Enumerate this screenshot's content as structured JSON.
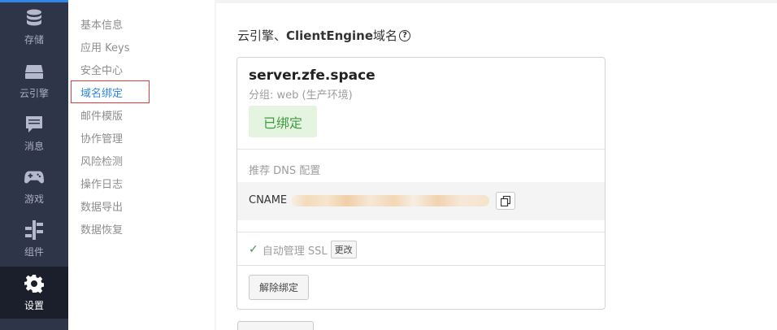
{
  "nav": {
    "items": [
      {
        "label": "存储",
        "icon": "database-icon"
      },
      {
        "label": "云引擎",
        "icon": "server-icon"
      },
      {
        "label": "消息",
        "icon": "message-icon"
      },
      {
        "label": "游戏",
        "icon": "gamepad-icon"
      },
      {
        "label": "组件",
        "icon": "components-icon"
      },
      {
        "label": "设置",
        "icon": "gear-icon",
        "active": true
      }
    ]
  },
  "submenu": {
    "items": [
      {
        "label": "基本信息"
      },
      {
        "label": "应用 Keys"
      },
      {
        "label": "安全中心"
      },
      {
        "label": "域名绑定",
        "active": true
      },
      {
        "label": "邮件模版"
      },
      {
        "label": "协作管理"
      },
      {
        "label": "风险检测"
      },
      {
        "label": "操作日志"
      },
      {
        "label": "数据导出"
      },
      {
        "label": "数据恢复"
      }
    ]
  },
  "main": {
    "title_prefix": "云引擎、",
    "title_bold": "ClientEngine",
    "title_suffix": " 域名",
    "card": {
      "domain": "server.zfe.space",
      "group": "分组: web (生产环境)",
      "status_badge": "已绑定",
      "dns_label": "推荐 DNS 配置",
      "cname_label": "CNAME",
      "ssl_label": "自动管理 SSL",
      "change_button": "更改",
      "unbind_button": "解除绑定"
    }
  },
  "colors": {
    "nav_bg": "#2f3548",
    "nav_active_bg": "#1b1f2b",
    "accent": "#2f86e6",
    "success": "#3f9b3f",
    "highlight_border": "#e23b3b"
  }
}
